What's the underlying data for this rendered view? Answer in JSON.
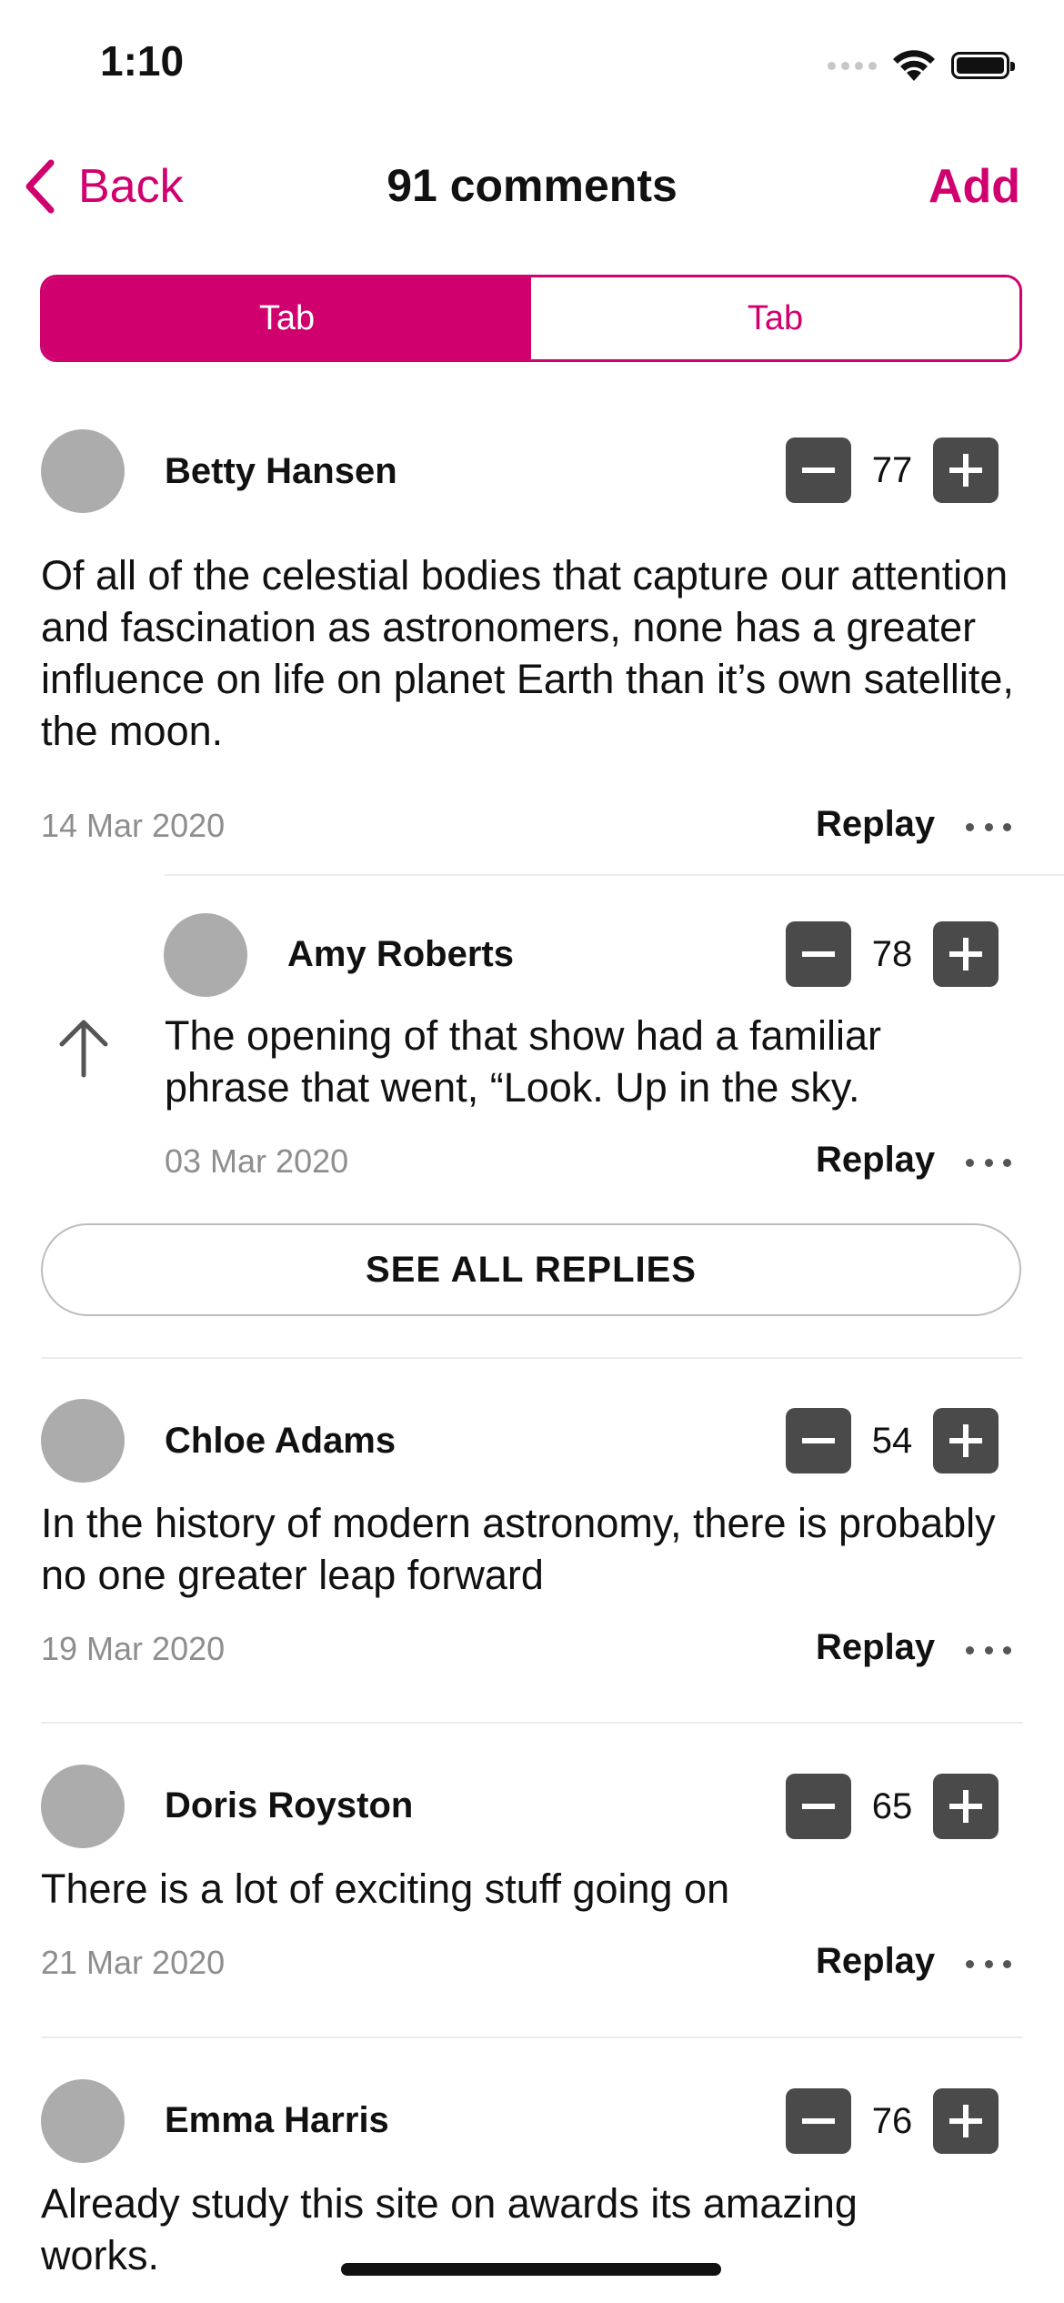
{
  "status_bar": {
    "time": "1:10",
    "icons": [
      "cellular-dots-icon",
      "wifi-icon",
      "battery-icon"
    ]
  },
  "nav": {
    "back_label": "Back",
    "title": "91 comments",
    "add_label": "Add"
  },
  "tabs": [
    {
      "label": "Tab",
      "active": true
    },
    {
      "label": "Tab",
      "active": false
    }
  ],
  "colors": {
    "accent": "#d0006f",
    "avatar": "#acacac",
    "vote_button": "#4a4a4a",
    "date_text": "#8e8e8e"
  },
  "comments": [
    {
      "author": "Betty Hansen",
      "votes": "77",
      "text": "Of all of the celestial bodies that capture our attention and fascination as astronomers, none has a greater influence on life on planet Earth than it’s own satellite, the moon.",
      "date": "14 Mar 2020",
      "reply_label": "Replay",
      "replies": [
        {
          "author": "Amy Roberts",
          "votes": "78",
          "text": "The opening of that show had a familiar phrase that went, “Look. Up in the sky.",
          "date": "03 Mar 2020",
          "reply_label": "Replay"
        }
      ],
      "see_all_label": "SEE ALL REPLIES"
    },
    {
      "author": "Chloe Adams",
      "votes": "54",
      "text": "In the history of modern astronomy, there is probably no one greater leap forward",
      "date": "19 Mar 2020",
      "reply_label": "Replay"
    },
    {
      "author": "Doris Royston",
      "votes": "65",
      "text": "There is a lot of exciting stuff going on",
      "date": "21 Mar 2020",
      "reply_label": "Replay"
    },
    {
      "author": "Emma Harris",
      "votes": "76",
      "text": "Already study this site on awards its amazing works."
    }
  ]
}
